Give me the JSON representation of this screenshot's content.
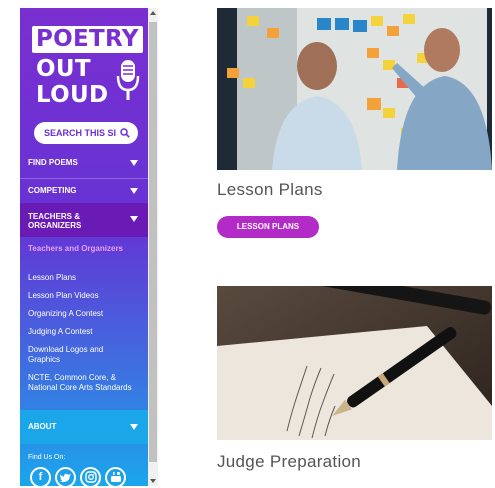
{
  "sidebar": {
    "logo": {
      "line1": "POETRY",
      "line2": "OUT",
      "line3": "LOUD"
    },
    "search_label": "SEARCH THIS SI",
    "menu": {
      "find_poems": "FIND POEMS",
      "competing": "COMPETING",
      "teachers": "TEACHERS & ORGANIZERS",
      "about": "ABOUT"
    },
    "submenu": [
      "Teachers and Organizers",
      "Lesson Plans",
      "Lesson Plan Videos",
      "Organizing A Contest",
      "Judging A Contest",
      "Download Logos and Graphics",
      "NCTE, Common Core, & National Core Arts Standards"
    ],
    "find_us": "Find Us On:",
    "social": [
      "f",
      "t",
      "i",
      "yt"
    ]
  },
  "cards": [
    {
      "title": "Lesson Plans",
      "button": "LESSON PLANS"
    },
    {
      "title": "Judge Preparation"
    }
  ],
  "colors": {
    "accent": "#b22bc7",
    "sidebar_top": "#7a2fd0",
    "sidebar_bottom": "#1aa6ec"
  }
}
